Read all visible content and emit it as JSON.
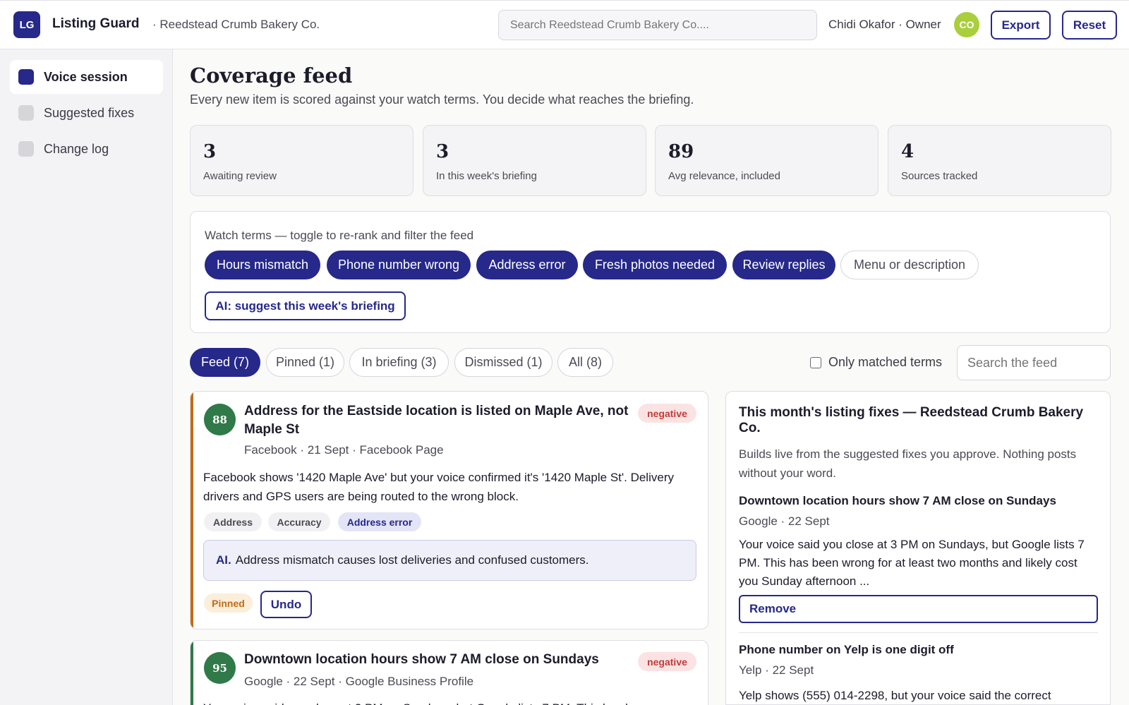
{
  "app": {
    "logo": "LG",
    "title": "Listing Guard",
    "org": "· Reedstead Crumb Bakery Co.",
    "search_placeholder": "Search Reedstead Crumb Bakery Co....",
    "user": "Chidi Okafor · Owner",
    "avatar": "CO",
    "export_label": "Export",
    "reset_label": "Reset"
  },
  "sidebar": {
    "items": [
      {
        "label": "Voice session",
        "active": true
      },
      {
        "label": "Suggested fixes",
        "active": false
      },
      {
        "label": "Change log",
        "active": false
      }
    ]
  },
  "page": {
    "title": "Coverage feed",
    "subtitle": "Every new item is scored against your watch terms. You decide what reaches the briefing."
  },
  "stats": [
    {
      "value": "3",
      "label": "Awaiting review"
    },
    {
      "value": "3",
      "label": "In this week's briefing"
    },
    {
      "value": "89",
      "label": "Avg relevance, included"
    },
    {
      "value": "4",
      "label": "Sources tracked"
    }
  ],
  "watch_terms": {
    "label": "Watch terms — toggle to re-rank and filter the feed",
    "chips": [
      {
        "label": "Hours mismatch",
        "on": true
      },
      {
        "label": "Phone number wrong",
        "on": true
      },
      {
        "label": "Address error",
        "on": true
      },
      {
        "label": "Fresh photos needed",
        "on": true
      },
      {
        "label": "Review replies",
        "on": true
      },
      {
        "label": "Menu or description",
        "on": false
      }
    ],
    "ai_button": "AI: suggest this week's briefing"
  },
  "tabs": [
    {
      "label": "Feed (7)",
      "active": true
    },
    {
      "label": "Pinned (1)",
      "active": false
    },
    {
      "label": "In briefing (3)",
      "active": false
    },
    {
      "label": "Dismissed (1)",
      "active": false
    },
    {
      "label": "All (8)",
      "active": false
    }
  ],
  "filters": {
    "only_matched_label": "Only matched terms",
    "only_matched_checked": false,
    "search_placeholder": "Search the feed"
  },
  "feed": [
    {
      "score": "88",
      "title": "Address for the Eastside location is listed on Maple Ave, not Maple St",
      "sentiment": "negative",
      "meta": "Facebook · 21 Sept · Facebook Page",
      "body": "Facebook shows '1420 Maple Ave' but your voice confirmed it's '1420 Maple St'. Delivery drivers and GPS users are being routed to the wrong block.",
      "tags": [
        "Address",
        "Accuracy",
        "Address error"
      ],
      "ai_prefix": "AI.",
      "ai_note": "Address mismatch causes lost deliveries and confused customers.",
      "status": "Pinned",
      "action": "Undo",
      "accent": "#c26b14"
    },
    {
      "score": "95",
      "title": "Downtown location hours show 7 AM close on Sundays",
      "sentiment": "negative",
      "meta": "Google · 22 Sept · Google Business Profile",
      "body": "Your voice said you close at 3 PM on Sundays, but Google lists 7 PM. This has been",
      "accent": "#2f7a48"
    }
  ],
  "briefing": {
    "title": "This month's listing fixes — Reedstead Crumb Bakery Co.",
    "subtitle": "Builds live from the suggested fixes you approve. Nothing posts without your word.",
    "items": [
      {
        "title": "Downtown location hours show 7 AM close on Sundays",
        "meta": "Google · 22 Sept",
        "body": "Your voice said you close at 3 PM on Sundays, but Google lists 7 PM. This has been wrong for at least two months and likely cost you Sunday afternoon ...",
        "action": "Remove"
      },
      {
        "title": "Phone number on Yelp is one digit off",
        "meta": "Yelp · 22 Sept",
        "body": "Yelp shows (555) 014-2298, but your voice said the correct"
      }
    ]
  }
}
